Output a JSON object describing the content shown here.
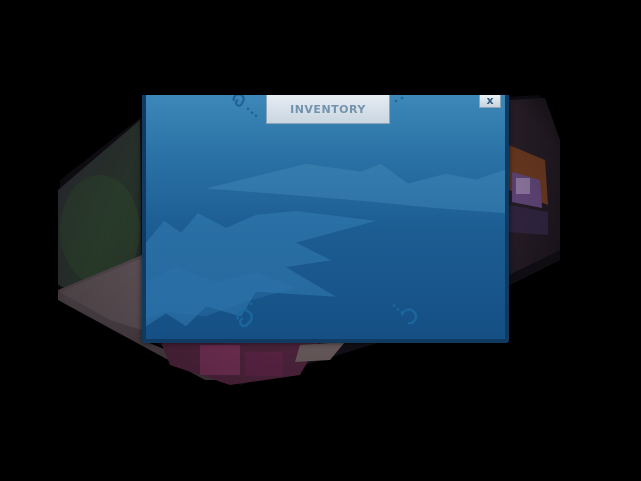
{
  "inventory": {
    "title": "INVENTORY",
    "close_label": "x"
  },
  "colors": {
    "background": "#000000",
    "panel_top": "#3d88b8",
    "panel_bottom": "#154f84",
    "panel_border": "#103a5f",
    "title_text": "#7393ad",
    "title_bg": "#dce5ec"
  },
  "icons": {
    "close": "close-icon",
    "swirl": "swirl-ornament"
  }
}
